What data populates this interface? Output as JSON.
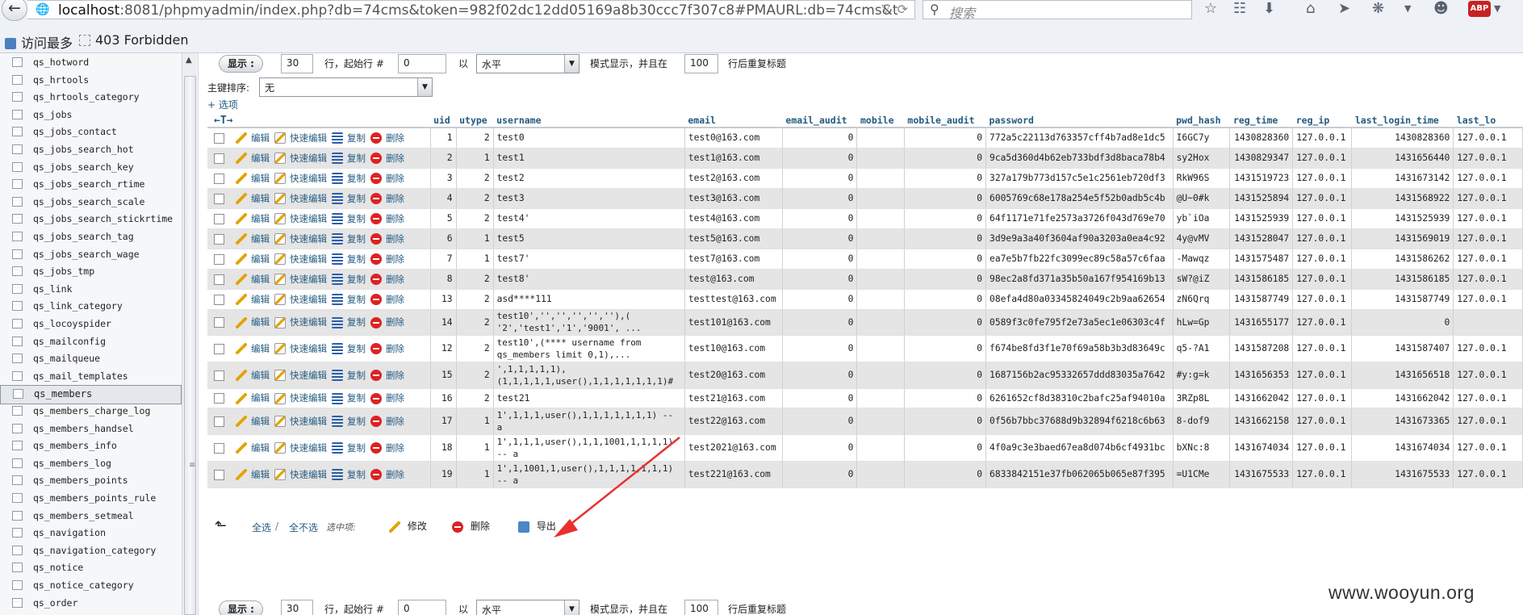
{
  "browser": {
    "url_host": "localhost",
    "url_rest": ":8081/phpmyadmin/index.php?db=74cms&token=982f02dc12dd05169a8b30ccc7f307c8#PMAURL:db=74cms&table=qs_members&",
    "search_placeholder": "搜索",
    "bookmarks": [
      "访问最多",
      "403 Forbidden"
    ],
    "toolbar_icons": [
      "star-icon",
      "reading-list-icon",
      "download-icon",
      "home-icon",
      "send-icon",
      "bug-icon",
      "chevron-down-icon",
      "chat-icon",
      "adblock-icon",
      "chevron-down-icon"
    ],
    "adblock_label": "ABP"
  },
  "sidebar": {
    "items": [
      "qs_hotword",
      "qs_hrtools",
      "qs_hrtools_category",
      "qs_jobs",
      "qs_jobs_contact",
      "qs_jobs_search_hot",
      "qs_jobs_search_key",
      "qs_jobs_search_rtime",
      "qs_jobs_search_scale",
      "qs_jobs_search_stickrtime",
      "qs_jobs_search_tag",
      "qs_jobs_search_wage",
      "qs_jobs_tmp",
      "qs_link",
      "qs_link_category",
      "qs_locoyspider",
      "qs_mailconfig",
      "qs_mailqueue",
      "qs_mail_templates",
      "qs_members",
      "qs_members_charge_log",
      "qs_members_handsel",
      "qs_members_info",
      "qs_members_log",
      "qs_members_points",
      "qs_members_points_rule",
      "qs_members_setmeal",
      "qs_navigation",
      "qs_navigation_category",
      "qs_notice",
      "qs_notice_category",
      "qs_order"
    ],
    "selected": "qs_members"
  },
  "controls": {
    "show_button": "显示 :",
    "rows_value": "30",
    "start_label": "行，起始行 #",
    "start_value": "0",
    "by_label": "以",
    "mode_value": "水平",
    "mode_suffix": "模式显示，并且在",
    "repeat_value": "100",
    "repeat_suffix": "行后重复标题",
    "sort_label": "主键排序:",
    "sort_value": "无",
    "options_link": "+ 选项",
    "nav_arrows": "←T→"
  },
  "actions": {
    "edit": "编辑",
    "quick_edit": "快速编辑",
    "copy": "复制",
    "delete": "删除"
  },
  "table": {
    "columns": [
      "uid",
      "utype",
      "username",
      "email",
      "email_audit",
      "mobile",
      "mobile_audit",
      "password",
      "pwd_hash",
      "reg_time",
      "reg_ip",
      "last_login_time",
      "last_lo"
    ],
    "rows": [
      {
        "uid": "1",
        "utype": "2",
        "username": "test0",
        "email": "test0@163.com",
        "email_audit": "0",
        "mobile": "",
        "mobile_audit": "0",
        "password": "772a5c22113d763357cff4b7ad8e1dc5",
        "pwd_hash": "I6GC7y",
        "reg_time": "1430828360",
        "reg_ip": "127.0.0.1",
        "last_login_time": "1430828360",
        "last_lo": "127.0.0.1"
      },
      {
        "uid": "2",
        "utype": "1",
        "username": "test1",
        "email": "test1@163.com",
        "email_audit": "0",
        "mobile": "",
        "mobile_audit": "0",
        "password": "9ca5d360d4b62eb733bdf3d8baca78b4",
        "pwd_hash": "sy2Hox",
        "reg_time": "1430829347",
        "reg_ip": "127.0.0.1",
        "last_login_time": "1431656440",
        "last_lo": "127.0.0.1"
      },
      {
        "uid": "3",
        "utype": "2",
        "username": "test2",
        "email": "test2@163.com",
        "email_audit": "0",
        "mobile": "",
        "mobile_audit": "0",
        "password": "327a179b773d157c5e1c2561eb720df3",
        "pwd_hash": "RkW96S",
        "reg_time": "1431519723",
        "reg_ip": "127.0.0.1",
        "last_login_time": "1431673142",
        "last_lo": "127.0.0.1"
      },
      {
        "uid": "4",
        "utype": "2",
        "username": "test3",
        "email": "test3@163.com",
        "email_audit": "0",
        "mobile": "",
        "mobile_audit": "0",
        "password": "6005769c68e178a254e5f52b0adb5c4b",
        "pwd_hash": "@U~0#k",
        "reg_time": "1431525894",
        "reg_ip": "127.0.0.1",
        "last_login_time": "1431568922",
        "last_lo": "127.0.0.1"
      },
      {
        "uid": "5",
        "utype": "2",
        "username": "test4'",
        "email": "test4@163.com",
        "email_audit": "0",
        "mobile": "",
        "mobile_audit": "0",
        "password": "64f1171e71fe2573a3726f043d769e70",
        "pwd_hash": "yb`iOa",
        "reg_time": "1431525939",
        "reg_ip": "127.0.0.1",
        "last_login_time": "1431525939",
        "last_lo": "127.0.0.1"
      },
      {
        "uid": "6",
        "utype": "1",
        "username": "test5",
        "email": "test5@163.com",
        "email_audit": "0",
        "mobile": "",
        "mobile_audit": "0",
        "password": "3d9e9a3a40f3604af90a3203a0ea4c92",
        "pwd_hash": "4y@vMV",
        "reg_time": "1431528047",
        "reg_ip": "127.0.0.1",
        "last_login_time": "1431569019",
        "last_lo": "127.0.0.1"
      },
      {
        "uid": "7",
        "utype": "1",
        "username": "test7'",
        "email": "test7@163.com",
        "email_audit": "0",
        "mobile": "",
        "mobile_audit": "0",
        "password": "ea7e5b7fb22fc3099ec89c58a57c6faa",
        "pwd_hash": "-Mawqz",
        "reg_time": "1431575487",
        "reg_ip": "127.0.0.1",
        "last_login_time": "1431586262",
        "last_lo": "127.0.0.1"
      },
      {
        "uid": "8",
        "utype": "2",
        "username": "test8'",
        "email": "test@163.com",
        "email_audit": "0",
        "mobile": "",
        "mobile_audit": "0",
        "password": "98ec2a8fd371a35b50a167f954169b13",
        "pwd_hash": "sW?@iZ",
        "reg_time": "1431586185",
        "reg_ip": "127.0.0.1",
        "last_login_time": "1431586185",
        "last_lo": "127.0.0.1"
      },
      {
        "uid": "13",
        "utype": "2",
        "username": "asd****111",
        "email": "testtest@163.com",
        "email_audit": "0",
        "mobile": "",
        "mobile_audit": "0",
        "password": "08efa4d80a03345824049c2b9aa62654",
        "pwd_hash": "zN6Qrq",
        "reg_time": "1431587749",
        "reg_ip": "127.0.0.1",
        "last_login_time": "1431587749",
        "last_lo": "127.0.0.1"
      },
      {
        "uid": "14",
        "utype": "2",
        "username": "test10','','','','',''),( '2','test1','1','9001', ...",
        "email": "test101@163.com",
        "email_audit": "0",
        "mobile": "",
        "mobile_audit": "0",
        "password": "0589f3c0fe795f2e73a5ec1e06303c4f",
        "pwd_hash": "hLw=Gp",
        "reg_time": "1431655177",
        "reg_ip": "127.0.0.1",
        "last_login_time": "0",
        "last_lo": ""
      },
      {
        "uid": "12",
        "utype": "2",
        "username": "test10',(**** username from qs_members limit 0,1),...",
        "email": "test10@163.com",
        "email_audit": "0",
        "mobile": "",
        "mobile_audit": "0",
        "password": "f674be8fd3f1e70f69a58b3b3d83649c",
        "pwd_hash": "q5-?A1",
        "reg_time": "1431587208",
        "reg_ip": "127.0.0.1",
        "last_login_time": "1431587407",
        "last_lo": "127.0.0.1"
      },
      {
        "uid": "15",
        "utype": "2",
        "username": "',1,1,1,1,1), (1,1,1,1,1,user(),1,1,1,1,1,1,1)#",
        "email": "test20@163.com",
        "email_audit": "0",
        "mobile": "",
        "mobile_audit": "0",
        "password": "1687156b2ac95332657ddd83035a7642",
        "pwd_hash": "#y:g=k",
        "reg_time": "1431656353",
        "reg_ip": "127.0.0.1",
        "last_login_time": "1431656518",
        "last_lo": "127.0.0.1"
      },
      {
        "uid": "16",
        "utype": "2",
        "username": "test21",
        "email": "test21@163.com",
        "email_audit": "0",
        "mobile": "",
        "mobile_audit": "0",
        "password": "6261652cf8d38310c2bafc25af94010a",
        "pwd_hash": "3RZp8L",
        "reg_time": "1431662042",
        "reg_ip": "127.0.0.1",
        "last_login_time": "1431662042",
        "last_lo": "127.0.0.1"
      },
      {
        "uid": "17",
        "utype": "1",
        "username": "1',1,1,1,user(),1,1,1,1,1,1,1) -- a",
        "email": "test22@163.com",
        "email_audit": "0",
        "mobile": "",
        "mobile_audit": "0",
        "password": "0f56b7bbc37688d9b32894f6218c6b63",
        "pwd_hash": "8-dof9",
        "reg_time": "1431662158",
        "reg_ip": "127.0.0.1",
        "last_login_time": "1431673365",
        "last_lo": "127.0.0.1"
      },
      {
        "uid": "18",
        "utype": "1",
        "username": "1',1,1,1,user(),1,1,1001,1,1,1,1) -- a",
        "email": "test2021@163.com",
        "email_audit": "0",
        "mobile": "",
        "mobile_audit": "0",
        "password": "4f0a9c3e3baed67ea8d074b6cf4931bc",
        "pwd_hash": "bXNc:8",
        "reg_time": "1431674034",
        "reg_ip": "127.0.0.1",
        "last_login_time": "1431674034",
        "last_lo": "127.0.0.1"
      },
      {
        "uid": "19",
        "utype": "1",
        "username": "1',1,1001,1,user(),1,1,1,1,1,1,1) -- a",
        "email": "test221@163.com",
        "email_audit": "0",
        "mobile": "",
        "mobile_audit": "0",
        "password": "6833842151e37fb062065b065e87f395",
        "pwd_hash": "=U1CMe",
        "reg_time": "1431675533",
        "reg_ip": "127.0.0.1",
        "last_login_time": "1431675533",
        "last_lo": "127.0.0.1"
      }
    ]
  },
  "bottom": {
    "select_all": "全选",
    "separator": "/",
    "deselect_all": "全不选",
    "selected_label": "选中项:",
    "modify": "修改",
    "delete": "删除",
    "export": "导出"
  },
  "watermark": "www.wooyun.org",
  "colors": {
    "link": "#235a81",
    "row_alt": "#e5e5e5",
    "arrow": "#e8312f",
    "delete": "#dd2222"
  }
}
